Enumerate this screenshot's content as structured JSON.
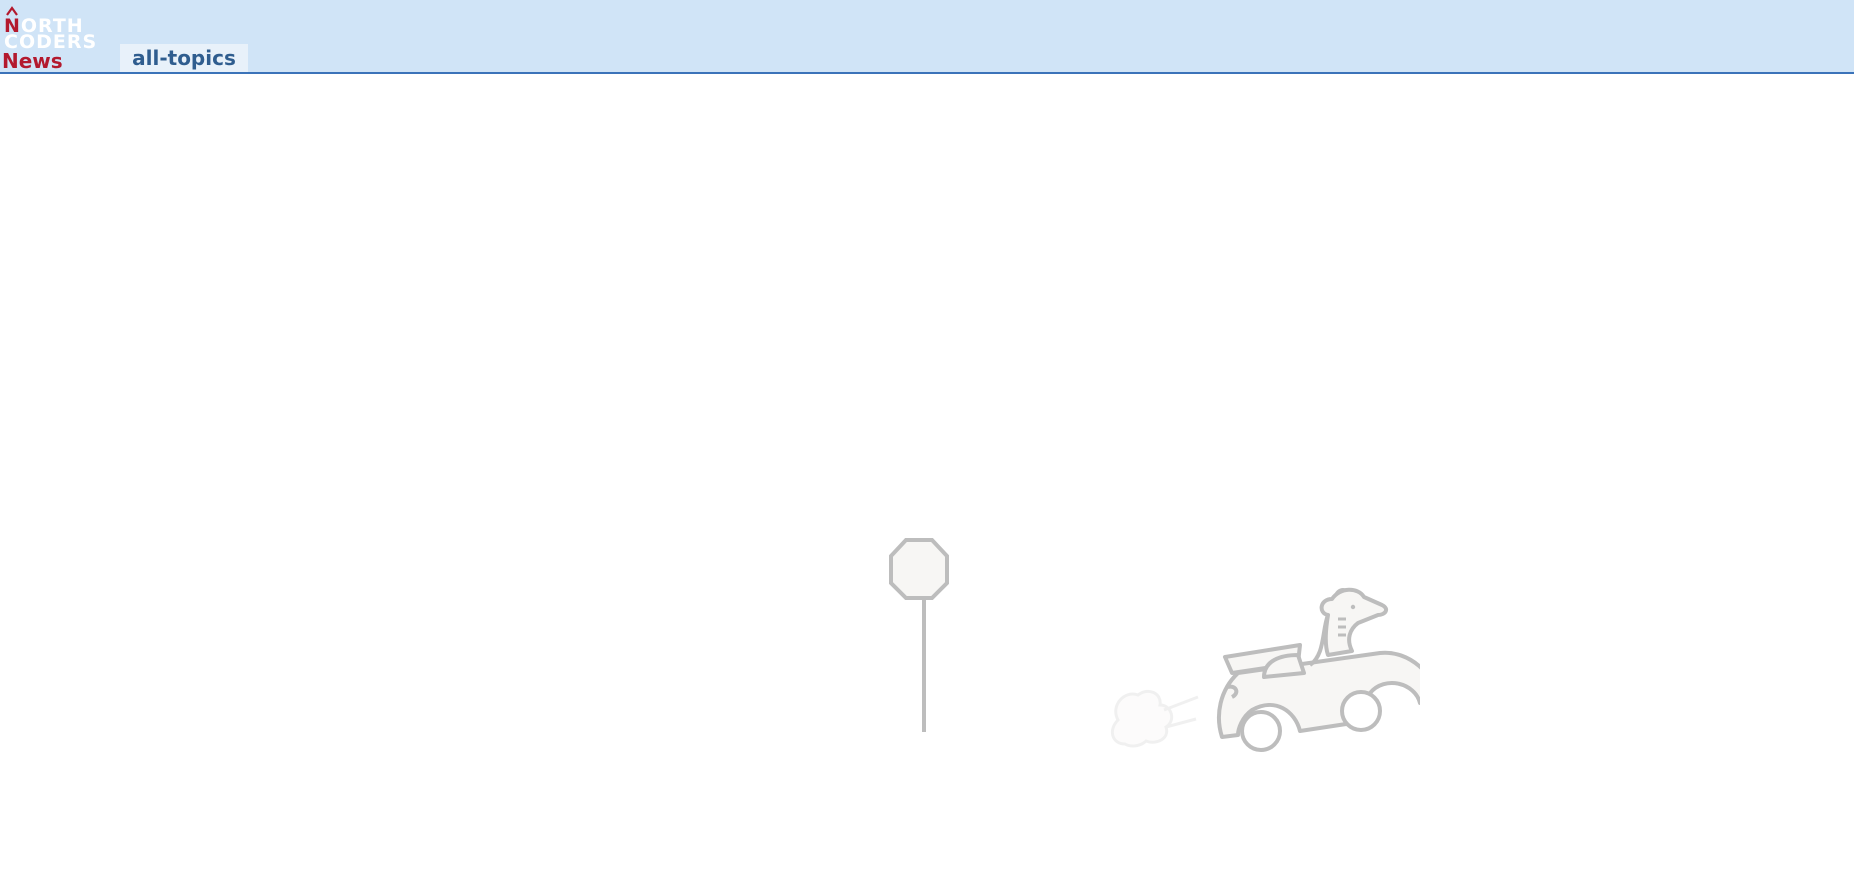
{
  "header": {
    "logo": {
      "line1_first": "N",
      "line1_rest": "ORTH",
      "line2": "CODERS",
      "line3": "News"
    },
    "tabs": [
      {
        "label": "all-topics"
      }
    ]
  },
  "colors": {
    "header_bg": "#d0e4f7",
    "header_border": "#3b73b9",
    "brand_red": "#b3192e",
    "tab_text": "#2f5d8f",
    "illustration_stroke": "#bdbdbd"
  },
  "illustration": {
    "icons": [
      "stop-sign-icon",
      "car-with-dog-icon",
      "exhaust-cloud-icon"
    ]
  }
}
